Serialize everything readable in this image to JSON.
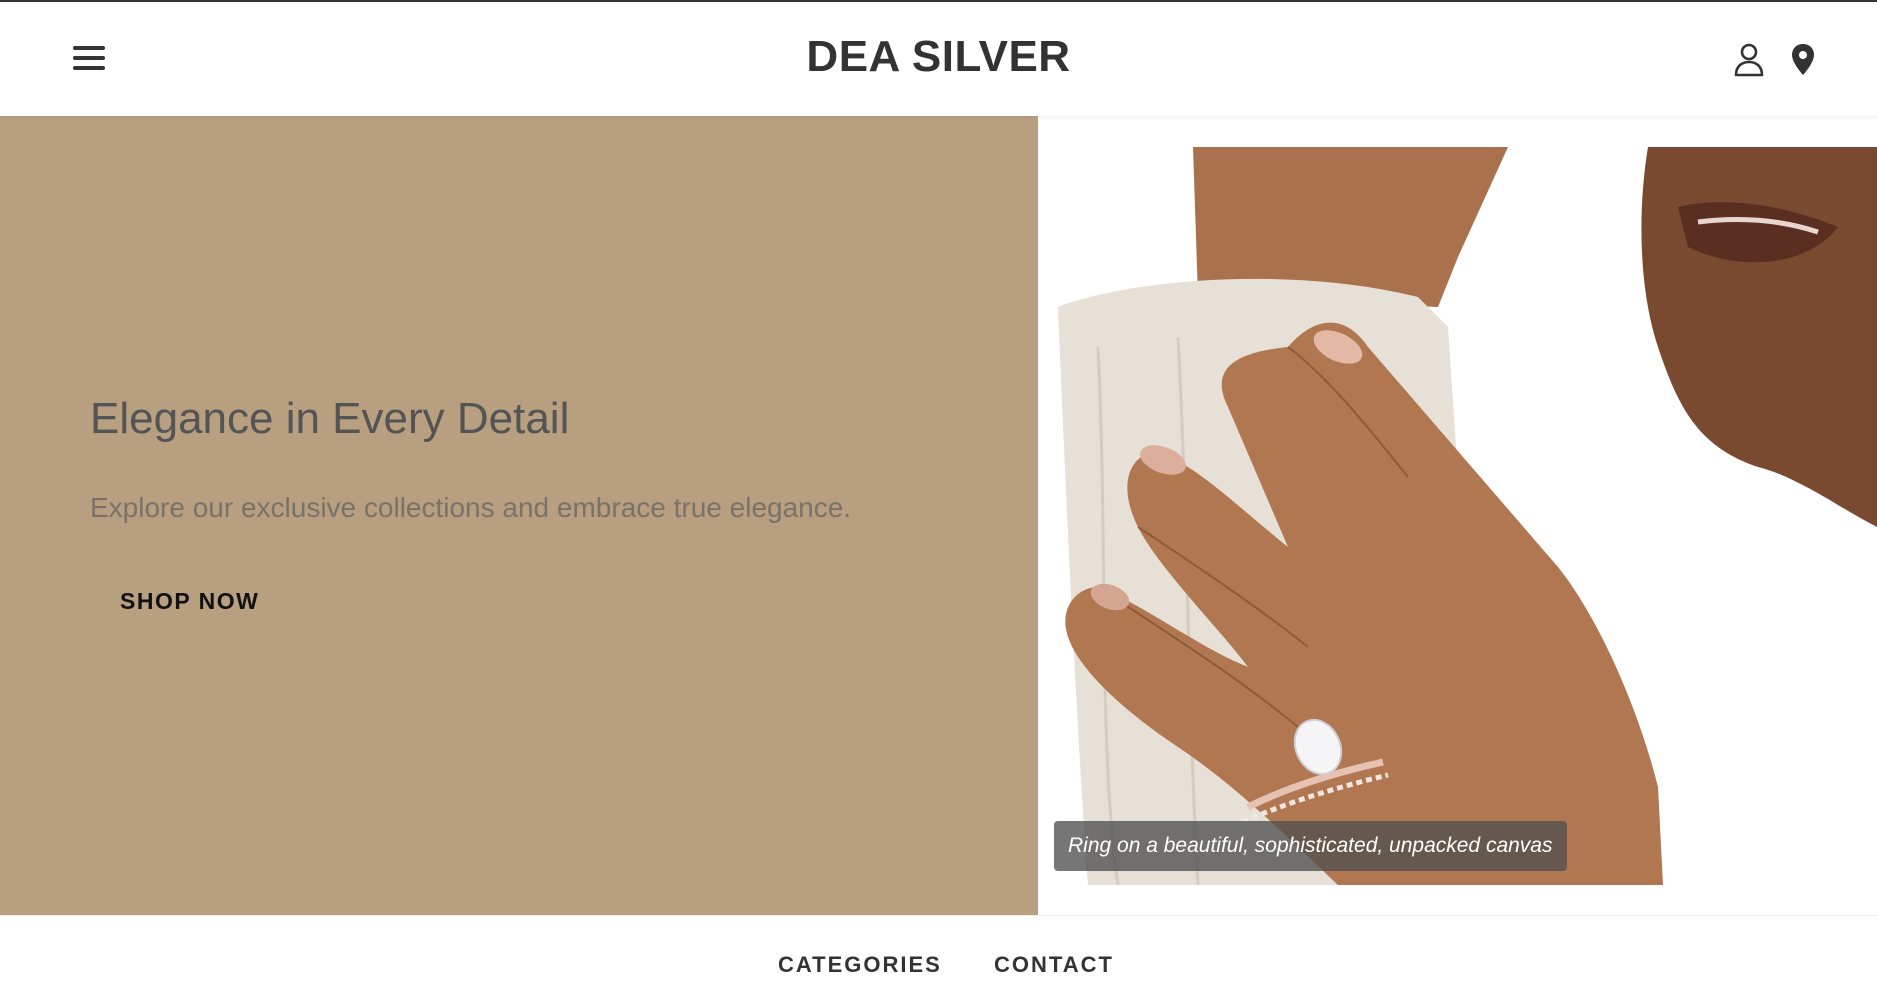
{
  "header": {
    "brand": "DEA SILVER",
    "menu_icon": "hamburger-menu-icon",
    "user_icon": "user-account-icon",
    "location_icon": "location-pin-icon"
  },
  "hero": {
    "title": "Elegance in Every Detail",
    "subtitle": "Explore our exclusive collections and embrace true elegance.",
    "cta_label": "SHOP NOW",
    "image_caption": "Ring on a beautiful, sophisticated, unpacked canvas",
    "background_color": "#b79f80"
  },
  "bottom_nav": {
    "items": [
      {
        "label": "CATEGORIES"
      },
      {
        "label": "CONTACT"
      }
    ]
  }
}
